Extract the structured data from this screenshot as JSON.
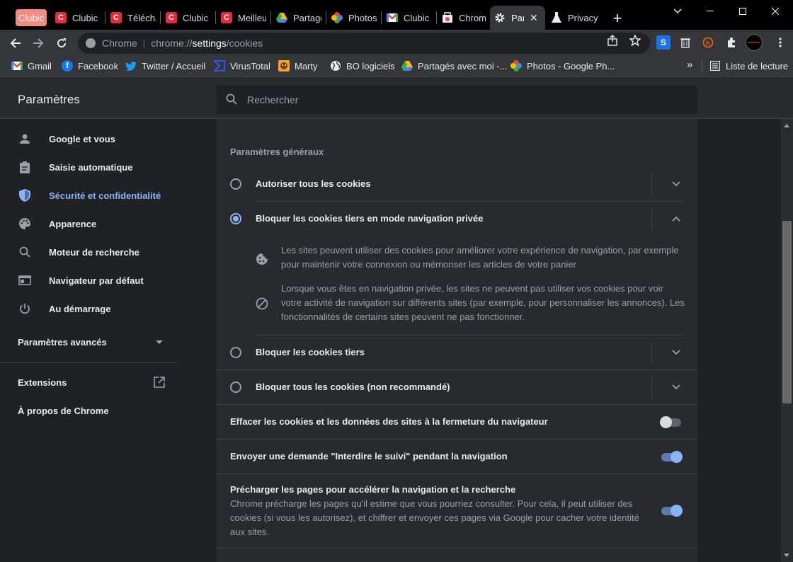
{
  "tabs": [
    {
      "title": "Clubic",
      "icon": "clubic-icon",
      "color": "#e8293b"
    },
    {
      "title": "Télécha",
      "icon": "clubic-icon",
      "color": "#e8293b"
    },
    {
      "title": "Clubic",
      "icon": "clubic-icon",
      "color": "#e8293b"
    },
    {
      "title": "Meilleu",
      "icon": "clubic-icon",
      "color": "#e8293b"
    },
    {
      "title": "Partagé",
      "icon": "google-drive-icon",
      "color": "#34a853"
    },
    {
      "title": "Photos",
      "icon": "google-photos-icon",
      "color": "#fbbc04"
    },
    {
      "title": "Clubic :",
      "icon": "gmail-icon",
      "color": "#ea4335"
    },
    {
      "title": "Chrome",
      "icon": "chrome-store-icon",
      "color": "#4285f4"
    },
    {
      "title": "Para",
      "icon": "gear-icon",
      "color": "#e8eaed"
    },
    {
      "title": "Privacy",
      "icon": "flask-icon",
      "color": "#ffffff"
    }
  ],
  "pinned_tab_label": "Clubic",
  "omnibox": {
    "chrome_label": "Chrome",
    "separator": "|",
    "url_scheme": "chrome://",
    "url_host": "settings",
    "url_path": "/cookies"
  },
  "bookmarks": [
    {
      "label": "Gmail",
      "icon": "gmail-icon"
    },
    {
      "label": "Facebook",
      "icon": "facebook-icon"
    },
    {
      "label": "Twitter / Accueil",
      "icon": "twitter-icon"
    },
    {
      "label": "VirusTotal",
      "icon": "virustotal-icon"
    },
    {
      "label": "Marty",
      "icon": "marty-icon"
    },
    {
      "label": "BO logiciels",
      "icon": "globe-icon"
    },
    {
      "label": "Partagés avec moi -...",
      "icon": "google-drive-icon"
    },
    {
      "label": "Photos - Google Ph...",
      "icon": "google-photos-icon"
    }
  ],
  "reading_list": "Liste de lecture",
  "overflow_label": "»",
  "settings": {
    "title": "Paramètres",
    "search_placeholder": "Rechercher"
  },
  "sidebar": {
    "items": [
      {
        "label": "Google et vous",
        "icon": "person-icon"
      },
      {
        "label": "Saisie automatique",
        "icon": "clipboard-icon"
      },
      {
        "label": "Sécurité et confidentialité",
        "icon": "shield-icon"
      },
      {
        "label": "Apparence",
        "icon": "palette-icon"
      },
      {
        "label": "Moteur de recherche",
        "icon": "search-icon"
      },
      {
        "label": "Navigateur par défaut",
        "icon": "browser-icon"
      },
      {
        "label": "Au démarrage",
        "icon": "power-icon"
      }
    ],
    "advanced": "Paramètres avancés",
    "extensions": "Extensions",
    "about": "À propos de Chrome"
  },
  "main": {
    "section_title": "Paramètres généraux",
    "options": [
      {
        "label": "Autoriser tous les cookies",
        "selected": false
      },
      {
        "label": "Bloquer les cookies tiers en mode navigation privée",
        "selected": true
      },
      {
        "label": "Bloquer les cookies tiers",
        "selected": false
      },
      {
        "label": "Bloquer tous les cookies (non recommandé)",
        "selected": false
      }
    ],
    "details": [
      {
        "text": "Les sites peuvent utiliser des cookies pour améliorer votre expérience de navigation, par exemple pour maintenir votre connexion ou mémoriser les articles de votre panier",
        "icon": "cookie-icon"
      },
      {
        "text": "Lorsque vous êtes en navigation privée, les sites ne peuvent pas utiliser vos cookies pour voir votre activité de navigation sur différents sites (par exemple, pour personnaliser les annonces). Les fonctionnalités de certains sites peuvent ne pas fonctionner.",
        "icon": "block-icon"
      }
    ],
    "toggles": [
      {
        "label": "Effacer les cookies et les données des sites à la fermeture du navigateur",
        "on": false
      },
      {
        "label": "Envoyer une demande \"Interdire le suivi\" pendant la navigation",
        "on": true
      },
      {
        "label": "Précharger les pages pour accélérer la navigation et la recherche",
        "sub": "Chrome précharge les pages qu'il estime que vous pourriez consulter. Pour cela, il peut utiliser des cookies (si vous les autorisez), et chiffrer et envoyer ces pages via Google pour cacher votre identité aux sites.",
        "on": true
      }
    ]
  },
  "colors": {
    "accent": "#8ab4f8",
    "background": "#202124",
    "card": "#292a2d"
  }
}
